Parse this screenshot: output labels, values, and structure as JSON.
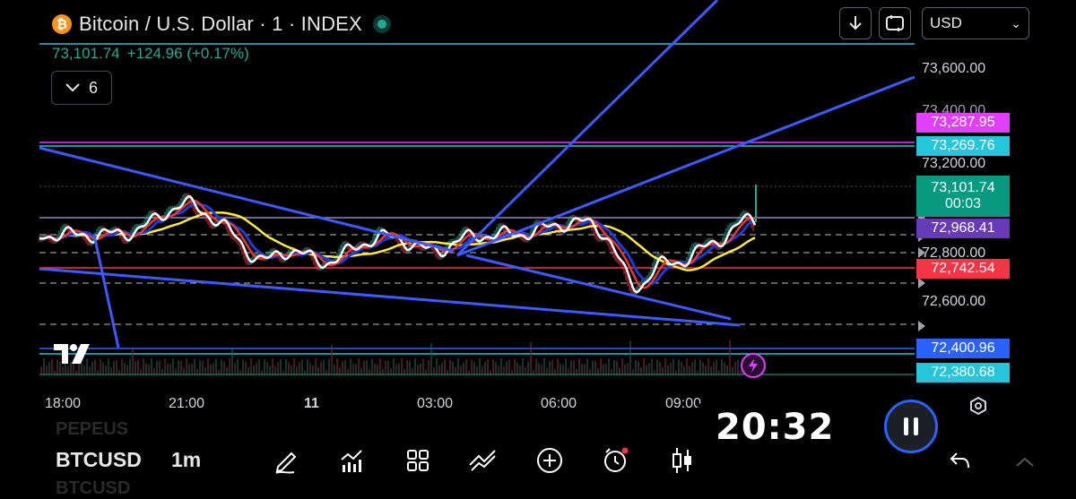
{
  "header": {
    "title": "Bitcoin / U.S. Dollar · 1 · INDEX",
    "logo_glyph": "₿",
    "last_price": "73,101.74",
    "change": "+124.96 (+0.17%)",
    "indicator_count": "6",
    "collapse_icon": "chevron-down-icon",
    "download_icon": "arrow-down-icon",
    "fullscreen_icon": "fullscreen-icon"
  },
  "currency": {
    "selected": "USD",
    "caret": "⌄"
  },
  "price_axis": {
    "labels": [
      "73,600.00",
      "73,200.00",
      "72,800.00",
      "72,600.00"
    ],
    "partial_labels": [
      "73,400.00"
    ],
    "badges": [
      {
        "text": "73,287.95",
        "color": "#e040fb"
      },
      {
        "text": "73,269.76",
        "color": "#26c6da"
      },
      {
        "text": "73,101.74",
        "color": "#089981"
      },
      {
        "text": "00:03",
        "color": "#089981"
      },
      {
        "text": "72,968.41",
        "color": "#673ab7"
      },
      {
        "text": "72,742.54",
        "color": "#f23645"
      },
      {
        "text": "72,400.96",
        "color": "#2962ff"
      },
      {
        "text": "72,380.68",
        "color": "#26c6da"
      }
    ]
  },
  "time_axis": {
    "labels": [
      "18:00",
      "21:00",
      "11",
      "03:00",
      "06:00",
      "09:00"
    ]
  },
  "toolbar": {
    "symbol": "BTCUSD",
    "symbol_ghost_above": "PEPEUS",
    "symbol_ghost_below": "BTCUSD",
    "interval": "1m",
    "icons": [
      "pencil-icon",
      "chart-add-icon",
      "grid-icon",
      "indicator-icon",
      "plus-circle-icon",
      "alarm-icon",
      "candlestick-icon",
      "chevron-icon",
      "undo-icon"
    ]
  },
  "recorder": {
    "time": "20:32",
    "icon": "pause-icon"
  },
  "colors": {
    "up": "#22ab94",
    "down": "#f23645",
    "trendline": "#3d5afe",
    "ma_fast": "#ffffff",
    "ma_red": "#e53935",
    "ma_blue": "#1e3ad8",
    "ma_yellow": "#ffeb3b"
  }
}
